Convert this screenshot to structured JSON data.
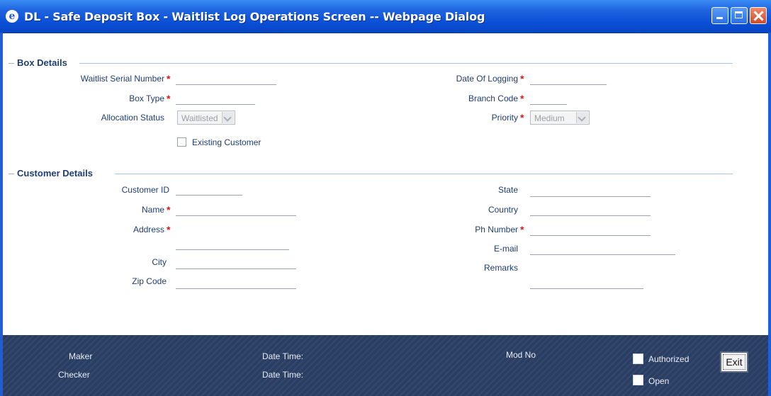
{
  "window": {
    "title": "DL - Safe Deposit Box - Waitlist Log Operations Screen -- Webpage Dialog",
    "icon": "ie-icon"
  },
  "box_details": {
    "header": "Box Details",
    "waitlist_serial_number": {
      "label": "Waitlist Serial Number",
      "required": "*",
      "value": ""
    },
    "box_type": {
      "label": "Box Type",
      "required": "*",
      "value": ""
    },
    "allocation_status": {
      "label": "Allocation Status",
      "selected": "Waitlisted"
    },
    "existing_customer": {
      "label": "Existing Customer",
      "checked": false
    },
    "date_of_logging": {
      "label": "Date Of Logging",
      "required": "*",
      "value": ""
    },
    "branch_code": {
      "label": "Branch Code",
      "required": "*",
      "value": ""
    },
    "priority": {
      "label": "Priority",
      "required": "*",
      "selected": "Medium"
    }
  },
  "customer_details": {
    "header": "Customer Details",
    "customer_id": {
      "label": "Customer ID",
      "value": ""
    },
    "name": {
      "label": "Name",
      "required": "*",
      "value": ""
    },
    "address": {
      "label": "Address",
      "required": "*",
      "value": ""
    },
    "city": {
      "label": "City",
      "value": ""
    },
    "zip_code": {
      "label": "Zip Code",
      "value": ""
    },
    "state": {
      "label": "State",
      "value": ""
    },
    "country": {
      "label": "Country",
      "value": ""
    },
    "ph_number": {
      "label": "Ph Number",
      "required": "*",
      "value": ""
    },
    "email": {
      "label": "E-mail",
      "value": ""
    },
    "remarks": {
      "label": "Remarks",
      "value": ""
    }
  },
  "footer": {
    "maker": "Maker",
    "checker": "Checker",
    "date_time_1": "Date Time:",
    "date_time_2": "Date Time:",
    "mod_no": "Mod No",
    "authorized": "Authorized",
    "open": "Open",
    "exit": "Exit"
  },
  "colors": {
    "titlebar": "#0a4fd6",
    "label": "#1f3d73",
    "required": "#e01818",
    "footer": "#2a3d62"
  }
}
